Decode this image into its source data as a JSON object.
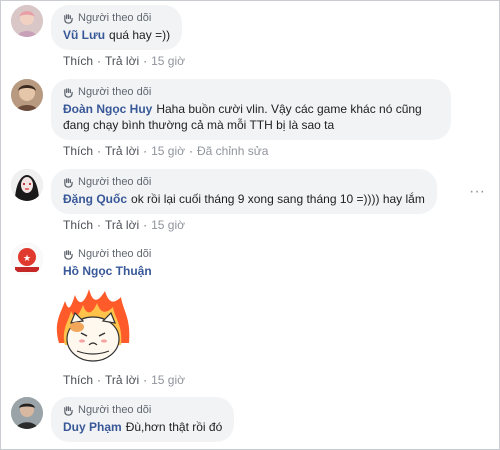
{
  "follower_label": "Người theo dõi",
  "actions": {
    "like": "Thích",
    "reply": "Trả lời",
    "sep": "·"
  },
  "more_glyph": "···",
  "colors": {
    "author": "#385898",
    "bubble": "#f2f3f5",
    "meta": "#606770"
  },
  "comments": [
    {
      "author": "Vũ Lưu",
      "text": "quá hay =))",
      "time": "15 giờ",
      "edited": "",
      "follower": true
    },
    {
      "author": "Đoàn Ngọc Huy",
      "text": "Haha buồn cười vlin. Vậy các game khác nó cũng đang chạy bình thường cả mà mỗi TTH bị là sao ta",
      "time": "15 giờ",
      "edited": "Đã chỉnh sửa",
      "follower": true
    },
    {
      "author": "Đặng Quốc",
      "text": "ok rồi lại cuối tháng 9 xong sang tháng 10 =)))) hay lắm",
      "time": "15 giờ",
      "edited": "",
      "follower": true
    },
    {
      "author": "Hồ Ngọc Thuận",
      "text": "",
      "time": "15 giờ",
      "edited": "",
      "follower": true,
      "sticker": "angry-cat-sticker"
    },
    {
      "author": "Duy Phạm",
      "text": "Đù,hơn thật rồi đó",
      "time": "",
      "edited": "",
      "follower": true
    }
  ]
}
